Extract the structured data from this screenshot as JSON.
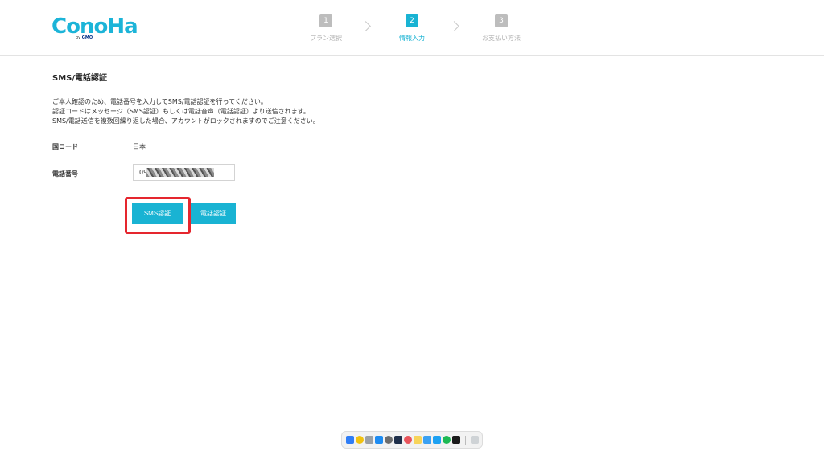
{
  "header": {
    "logo_text": "ConoHa",
    "logo_by": "by",
    "logo_gmo": "GMO",
    "steps": [
      {
        "num": "1",
        "label": "プラン選択"
      },
      {
        "num": "2",
        "label": "情報入力"
      },
      {
        "num": "3",
        "label": "お支払い方法"
      }
    ]
  },
  "main": {
    "title": "SMS/電話認証",
    "description": [
      "ご本人確認のため、電話番号を入力してSMS/電話認証を行ってください。",
      "認証コードはメッセージ（SMS認証）もしくは電話音声（電話認証）より送信されます。",
      "SMS/電話送信を複数回繰り返した場合、アカウントがロックされますのでご注意ください。"
    ],
    "country_label": "国コード",
    "country_value": "日本",
    "phone_label": "電話番号",
    "phone_value": "09",
    "sms_button": "SMS認証",
    "call_button": "電話認証"
  },
  "colors": {
    "accent": "#19b3d3",
    "highlight": "#e5262e"
  },
  "dock": {
    "icons": [
      "finder-icon",
      "chrome-icon",
      "launchpad-icon",
      "app-store-icon",
      "settings-icon",
      "photo-icon",
      "arc-icon",
      "notes-icon",
      "mail-icon",
      "twitter-icon",
      "spotify-icon",
      "terminal-icon",
      "trash-icon"
    ]
  }
}
